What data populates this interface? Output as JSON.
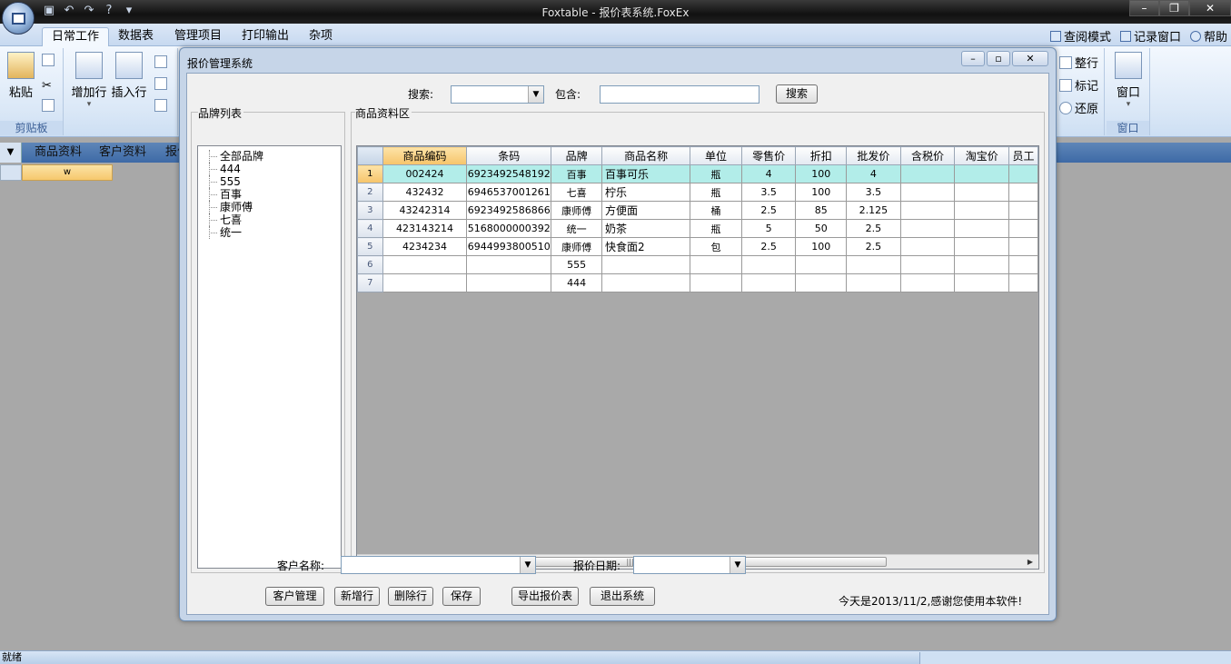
{
  "app": {
    "title": "Foxtable - 报价表系统.FoxEx"
  },
  "ribbon": {
    "tabs": [
      "日常工作",
      "数据表",
      "管理项目",
      "打印输出",
      "杂项"
    ],
    "right": [
      "查阅模式",
      "记录窗口",
      "帮助"
    ],
    "groups": {
      "clipboard": "剪贴板",
      "window": "窗口"
    },
    "buttons": {
      "paste": "粘贴",
      "add_row": "增加行",
      "insert_row": "插入行",
      "align_row": "整行",
      "mark": "标记",
      "restore": "还原",
      "window": "窗口"
    }
  },
  "doc_tabs": [
    "商品资料",
    "客户资料",
    "报价"
  ],
  "doc_cell": "w",
  "status": {
    "text": "就绪"
  },
  "dialog": {
    "title": "报价管理系统",
    "search_label": "搜索:",
    "contains_label": "包含:",
    "search_button": "搜索",
    "brand_group": "品牌列表",
    "product_group": "商品资料区",
    "brands": [
      "全部品牌",
      "444",
      "555",
      "百事",
      "康师傅",
      "七喜",
      "统一"
    ],
    "columns": [
      "商品编码",
      "条码",
      "品牌",
      "商品名称",
      "单位",
      "零售价",
      "折扣",
      "批发价",
      "含税价",
      "淘宝价",
      "员工"
    ],
    "rows": [
      [
        "1",
        "002424",
        "6923492548192",
        "百事",
        "百事可乐",
        "瓶",
        "4",
        "100",
        "4",
        "",
        "",
        ""
      ],
      [
        "2",
        "432432",
        "6946537001261",
        "七喜",
        "柠乐",
        "瓶",
        "3.5",
        "100",
        "3.5",
        "",
        "",
        ""
      ],
      [
        "3",
        "43242314",
        "6923492586866",
        "康师傅",
        "方便面",
        "桶",
        "2.5",
        "85",
        "2.125",
        "",
        "",
        ""
      ],
      [
        "4",
        "423143214",
        "5168000000392",
        "统一",
        "奶茶",
        "瓶",
        "5",
        "50",
        "2.5",
        "",
        "",
        ""
      ],
      [
        "5",
        "4234234",
        "6944993800510",
        "康师傅",
        "快食面2",
        "包",
        "2.5",
        "100",
        "2.5",
        "",
        "",
        ""
      ],
      [
        "6",
        "",
        "",
        "555",
        "",
        "",
        "",
        "",
        "",
        "",
        "",
        ""
      ],
      [
        "7",
        "",
        "",
        "444",
        "",
        "",
        "",
        "",
        "",
        "",
        "",
        ""
      ]
    ],
    "customer_label": "客户名称:",
    "date_label": "报价日期:",
    "buttons": [
      "客户管理",
      "新增行",
      "删除行",
      "保存",
      "导出报价表",
      "退出系统"
    ],
    "message": "今天是2013/11/2,感谢您使用本软件!"
  }
}
